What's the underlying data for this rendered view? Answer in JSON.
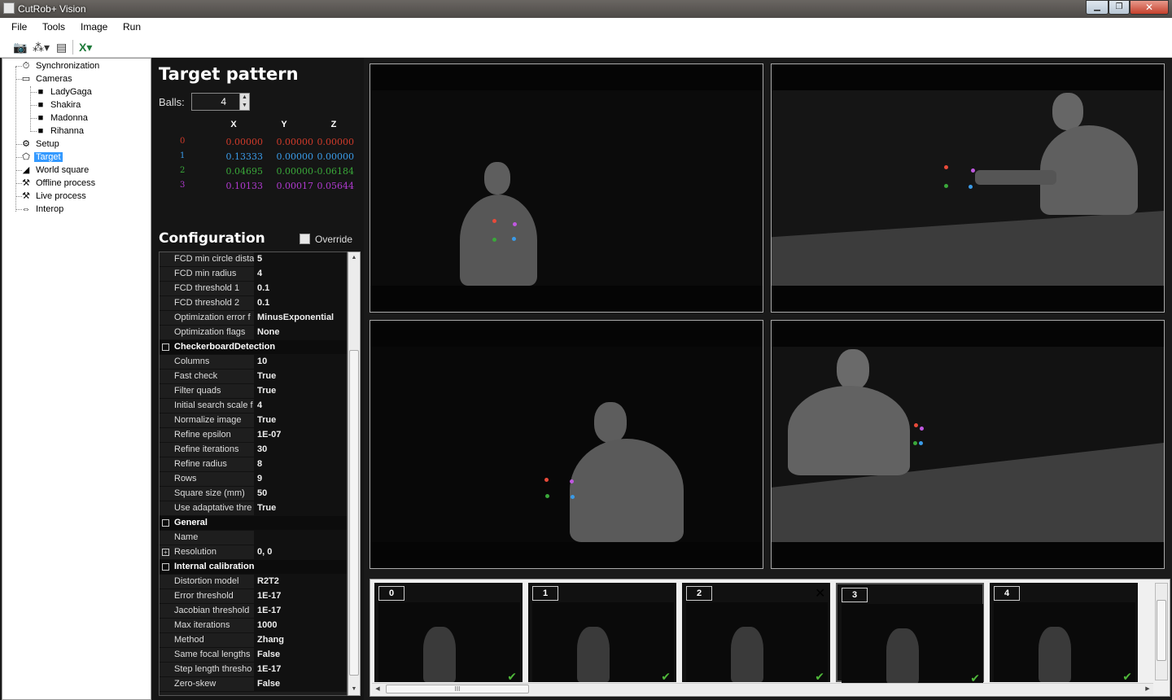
{
  "window": {
    "title": "CutRob+ Vision",
    "min": "▁",
    "max": "❐",
    "close": "✕"
  },
  "menu": [
    "File",
    "Tools",
    "Image",
    "Run"
  ],
  "toolbar": [
    {
      "icon": "camera-icon",
      "glyph": "📷"
    },
    {
      "icon": "nodes-icon",
      "glyph": "⁂▾"
    },
    {
      "icon": "film-icon",
      "glyph": "▤"
    },
    {
      "icon": "excel-icon",
      "glyph": "X▾"
    }
  ],
  "tree": [
    {
      "label": "Synchronization",
      "icon": "stopwatch-icon",
      "glyph": "⏱",
      "level": 1
    },
    {
      "label": "Cameras",
      "icon": "folder-icon",
      "glyph": "▭",
      "level": 1
    },
    {
      "label": "LadyGaga",
      "icon": "video-camera-icon",
      "glyph": "■",
      "level": 2
    },
    {
      "label": "Shakira",
      "icon": "video-camera-icon",
      "glyph": "■",
      "level": 2
    },
    {
      "label": "Madonna",
      "icon": "video-camera-icon",
      "glyph": "■",
      "level": 2
    },
    {
      "label": "Rihanna",
      "icon": "video-camera-icon",
      "glyph": "■",
      "level": 2
    },
    {
      "label": "Setup",
      "icon": "gear-icon",
      "glyph": "⚙",
      "level": 1
    },
    {
      "label": "Target",
      "icon": "target-icon",
      "glyph": "⬠",
      "level": 1,
      "selected": true
    },
    {
      "label": "World square",
      "icon": "set-square-icon",
      "glyph": "◢",
      "level": 1
    },
    {
      "label": "Offline process",
      "icon": "robot-arm-icon",
      "glyph": "⚒",
      "level": 1
    },
    {
      "label": "Live process",
      "icon": "robot-arm-icon",
      "glyph": "⚒",
      "level": 1
    },
    {
      "label": "Interop",
      "icon": "arrows-icon",
      "glyph": "⇔",
      "level": 1
    }
  ],
  "target": {
    "title": "Target pattern",
    "balls_label": "Balls:",
    "balls_value": "4",
    "headers": [
      "X",
      "Y",
      "Z"
    ],
    "rows": [
      {
        "id": "0",
        "color": "#d03a2a",
        "values": [
          "0.00000",
          "0.00000",
          "0.00000"
        ]
      },
      {
        "id": "1",
        "color": "#3a9be8",
        "values": [
          "0.13333",
          "0.00000",
          "0.00000"
        ]
      },
      {
        "id": "2",
        "color": "#3aa83a",
        "values": [
          "0.04695",
          "0.00000",
          "-0.06184"
        ]
      },
      {
        "id": "3",
        "color": "#b03ad0",
        "values": [
          "0.10133",
          "0.00017",
          "0.05644"
        ]
      }
    ]
  },
  "config": {
    "title": "Configuration",
    "override_label": "Override",
    "rows": [
      {
        "type": "prop",
        "key": "FCD min circle dista",
        "value": "5"
      },
      {
        "type": "prop",
        "key": "FCD min radius",
        "value": "4"
      },
      {
        "type": "prop",
        "key": "FCD threshold 1",
        "value": "0.1"
      },
      {
        "type": "prop",
        "key": "FCD threshold 2",
        "value": "0.1"
      },
      {
        "type": "prop",
        "key": "Optimization error f",
        "value": "MinusExponential"
      },
      {
        "type": "prop",
        "key": "Optimization flags",
        "value": "None"
      },
      {
        "type": "cat",
        "key": "CheckerboardDetection",
        "toggle": "−"
      },
      {
        "type": "prop",
        "key": "Columns",
        "value": "10"
      },
      {
        "type": "prop",
        "key": "Fast check",
        "value": "True"
      },
      {
        "type": "prop",
        "key": "Filter quads",
        "value": "True"
      },
      {
        "type": "prop",
        "key": "Initial search scale f",
        "value": "4"
      },
      {
        "type": "prop",
        "key": "Normalize image",
        "value": "True"
      },
      {
        "type": "prop",
        "key": "Refine epsilon",
        "value": "1E-07"
      },
      {
        "type": "prop",
        "key": "Refine iterations",
        "value": "30"
      },
      {
        "type": "prop",
        "key": "Refine radius",
        "value": "8"
      },
      {
        "type": "prop",
        "key": "Rows",
        "value": "9"
      },
      {
        "type": "prop",
        "key": "Square size (mm)",
        "value": "50"
      },
      {
        "type": "prop",
        "key": "Use adaptative thre",
        "value": "True"
      },
      {
        "type": "cat",
        "key": "General",
        "toggle": "−"
      },
      {
        "type": "prop",
        "key": "Name",
        "value": ""
      },
      {
        "type": "prop",
        "key": "Resolution",
        "value": "0, 0",
        "expandable": true
      },
      {
        "type": "cat",
        "key": "Internal calibration",
        "toggle": "−"
      },
      {
        "type": "prop",
        "key": "Distortion model",
        "value": "R2T2"
      },
      {
        "type": "prop",
        "key": "Error threshold",
        "value": "1E-17"
      },
      {
        "type": "prop",
        "key": "Jacobian threshold",
        "value": "1E-17"
      },
      {
        "type": "prop",
        "key": "Max iterations",
        "value": "1000"
      },
      {
        "type": "prop",
        "key": "Method",
        "value": "Zhang"
      },
      {
        "type": "prop",
        "key": "Same focal lengths",
        "value": "False"
      },
      {
        "type": "prop",
        "key": "Step length thresho",
        "value": "1E-17"
      },
      {
        "type": "prop",
        "key": "Zero-skew",
        "value": "False"
      }
    ]
  },
  "views": [
    {
      "name": "camera-view-1"
    },
    {
      "name": "camera-view-2"
    },
    {
      "name": "camera-view-3"
    },
    {
      "name": "camera-view-4"
    }
  ],
  "thumbnails": [
    {
      "label": "0",
      "checked": true
    },
    {
      "label": "1",
      "checked": true
    },
    {
      "label": "2",
      "checked": true
    },
    {
      "label": "3",
      "checked": true,
      "selected": true,
      "remove": "✕"
    },
    {
      "label": "4",
      "checked": true
    }
  ],
  "checkmark": "✔",
  "scroll_grip": "III"
}
